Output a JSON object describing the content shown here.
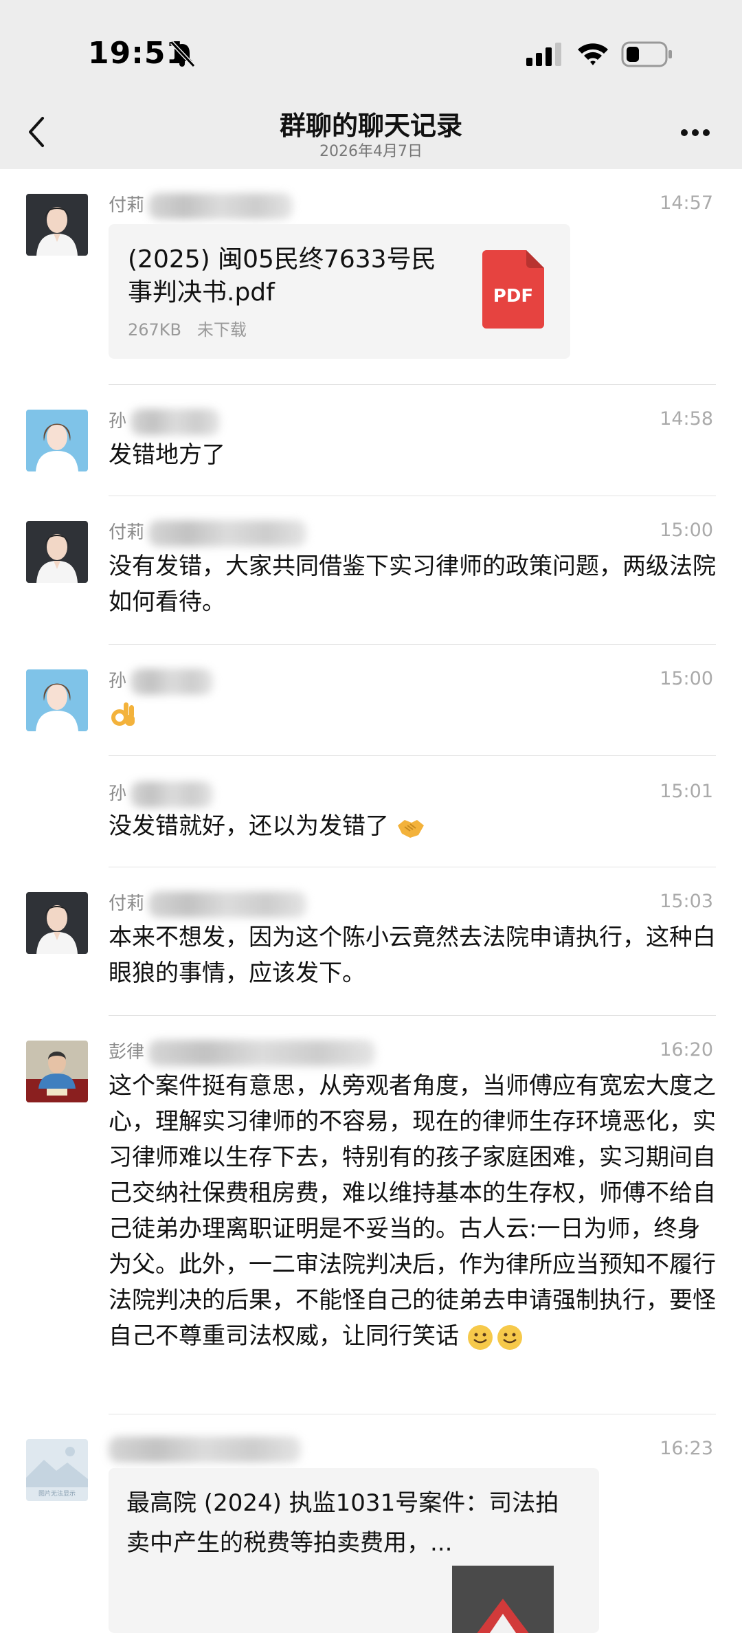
{
  "status_bar": {
    "time": "19:51",
    "bell_icon": "bell-muted-icon",
    "signal_icon": "cellular-signal-icon",
    "wifi_icon": "wifi-icon",
    "battery_icon": "battery-low-icon"
  },
  "nav": {
    "title": "群聊的聊天记录",
    "subtitle": "2026年4月7日",
    "back_icon": "chevron-left-icon",
    "more_icon": "more-dots-icon"
  },
  "messages": [
    {
      "sender": "付莉",
      "time": "14:57",
      "type": "file",
      "file": {
        "name": "(2025) 闽05民终7633号民事判决书.pdf",
        "size": "267KB",
        "status": "未下载",
        "icon_label": "PDF"
      }
    },
    {
      "sender": "孙",
      "time": "14:58",
      "type": "text",
      "text": "发错地方了"
    },
    {
      "sender": "付莉",
      "time": "15:00",
      "type": "text",
      "text": "没有发错，大家共同借鉴下实习律师的政策问题，两级法院如何看待。"
    },
    {
      "sender": "孙",
      "time": "15:00",
      "type": "emoji",
      "emoji": "ok-hand-emoji"
    },
    {
      "sender": "孙",
      "time": "15:01",
      "type": "text",
      "text": "没发错就好，还以为发错了",
      "emoji": "handshake-emoji"
    },
    {
      "sender": "付莉",
      "time": "15:03",
      "type": "text",
      "text": "本来不想发，因为这个陈小云竟然去法院申请执行，这种白眼狼的事情，应该发下。"
    },
    {
      "sender": "彭律",
      "time": "16:20",
      "type": "text",
      "text": "这个案件挺有意思，从旁观者角度，当师傅应有宽宏大度之心，理解实习律师的不容易，现在的律师生存环境恶化，实习律师难以生存下去，特别有的孩子家庭困难，实习期间自己交纳社保费租房费，难以维持基本的生存权，师傅不给自己徒弟办理离职证明是不妥当的。古人云:一日为师，终身为父。此外，一二审法院判决后，作为律所应当预知不履行法院判决的后果，不能怪自己的徒弟去申请强制执行，要怪自己不尊重司法权威，让同行笑话",
      "emoji": "smiling-face-emoji"
    },
    {
      "sender": "",
      "time": "16:23",
      "type": "link",
      "avatar_caption": "图片无法显示",
      "link": {
        "title": "最高院 (2024) 执监1031号案件：司法拍卖中产生的税费等拍卖费用，..."
      }
    }
  ]
}
